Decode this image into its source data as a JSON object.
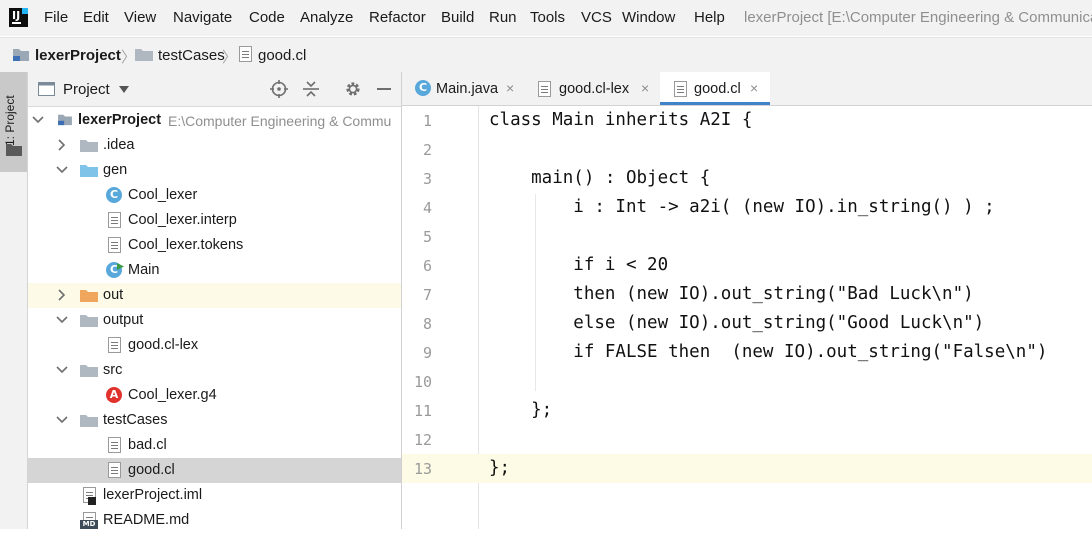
{
  "menu": [
    "File",
    "Edit",
    "View",
    "Navigate",
    "Code",
    "Analyze",
    "Refactor",
    "Build",
    "Run",
    "Tools",
    "VCS",
    "Window",
    "Help"
  ],
  "window_title": "lexerProject [E:\\Computer Engineering & Communica",
  "breadcrumb": [
    "lexerProject",
    "testCases",
    "good.cl"
  ],
  "tool_stripe": {
    "project_label": "1: Project"
  },
  "project_panel": {
    "title": "Project"
  },
  "tree": [
    {
      "label": "lexerProject",
      "path": "E:\\Computer Engineering & Commu",
      "kind": "module",
      "level": 0,
      "expanded": true
    },
    {
      "label": ".idea",
      "kind": "folder",
      "level": 1,
      "expanded": false
    },
    {
      "label": "gen",
      "kind": "folder-blue",
      "level": 1,
      "expanded": true
    },
    {
      "label": "Cool_lexer",
      "kind": "class",
      "level": 2
    },
    {
      "label": "Cool_lexer.interp",
      "kind": "file",
      "level": 2
    },
    {
      "label": "Cool_lexer.tokens",
      "kind": "file",
      "level": 2
    },
    {
      "label": "Main",
      "kind": "class-run",
      "level": 2
    },
    {
      "label": "out",
      "kind": "folder-orange",
      "level": 1,
      "expanded": false
    },
    {
      "label": "output",
      "kind": "folder",
      "level": 1,
      "expanded": true
    },
    {
      "label": "good.cl-lex",
      "kind": "file",
      "level": 2
    },
    {
      "label": "src",
      "kind": "folder",
      "level": 1,
      "expanded": true
    },
    {
      "label": "Cool_lexer.g4",
      "kind": "antlr",
      "level": 2
    },
    {
      "label": "testCases",
      "kind": "folder",
      "level": 1,
      "expanded": true
    },
    {
      "label": "bad.cl",
      "kind": "file",
      "level": 2
    },
    {
      "label": "good.cl",
      "kind": "file",
      "level": 2
    },
    {
      "label": "lexerProject.iml",
      "kind": "iml",
      "level": 1
    },
    {
      "label": "README.md",
      "kind": "md",
      "level": 1
    }
  ],
  "tabs": [
    {
      "label": "Main.java",
      "close": "×"
    },
    {
      "label": "good.cl-lex",
      "close": "×"
    },
    {
      "label": "good.cl",
      "close": "×"
    }
  ],
  "code_lines": [
    "class Main inherits A2I {",
    "",
    "    main() : Object {",
    "        i : Int -> a2i( (new IO).in_string() ) ;",
    "",
    "        if i < 20",
    "        then (new IO).out_string(\"Bad Luck\\n\")",
    "        else (new IO).out_string(\"Good Luck\\n\")",
    "        if FALSE then  (new IO).out_string(\"False\\n\")",
    "",
    "    };",
    "",
    "};"
  ],
  "line_numbers": [
    "1",
    "2",
    "3",
    "4",
    "5",
    "6",
    "7",
    "8",
    "9",
    "10",
    "11",
    "12",
    "13"
  ],
  "colors": {
    "accent": "#4083c9",
    "selection": "#d5d5d5",
    "current_line": "#fdfbe6",
    "folder": "#afb7c0",
    "folder_blue": "#7fc3e8",
    "folder_orange": "#f0a65c"
  },
  "icons": {
    "locate": "target-icon",
    "collapse": "collapse-all-icon",
    "settings": "gear-icon",
    "hide": "minimize-icon"
  }
}
